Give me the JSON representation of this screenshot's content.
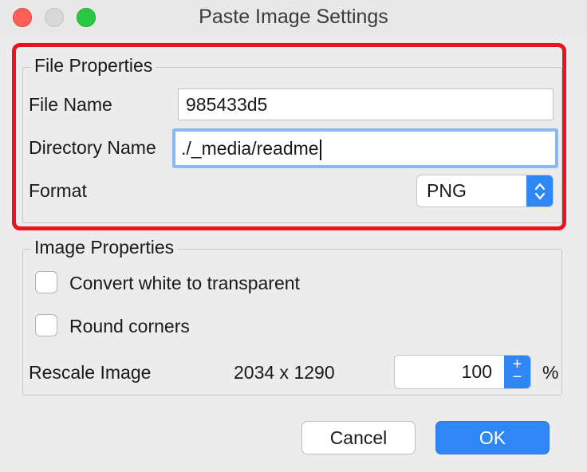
{
  "window": {
    "title": "Paste Image Settings"
  },
  "file_properties": {
    "legend": "File Properties",
    "file_name_label": "File Name",
    "file_name_value": "985433d5",
    "directory_label": "Directory Name",
    "directory_value": "./_media/readme",
    "format_label": "Format",
    "format_value": "PNG"
  },
  "image_properties": {
    "legend": "Image Properties",
    "convert_white_label": "Convert white to transparent",
    "convert_white_checked": false,
    "round_corners_label": "Round corners",
    "round_corners_checked": false,
    "rescale_label": "Rescale Image",
    "dimensions": "2034 x 1290",
    "scale_value": "100",
    "percent_symbol": "%"
  },
  "buttons": {
    "cancel": "Cancel",
    "ok": "OK"
  },
  "colors": {
    "accent": "#2f86f5",
    "highlight": "#e8141e",
    "focus_ring": "#8ab8f2"
  }
}
